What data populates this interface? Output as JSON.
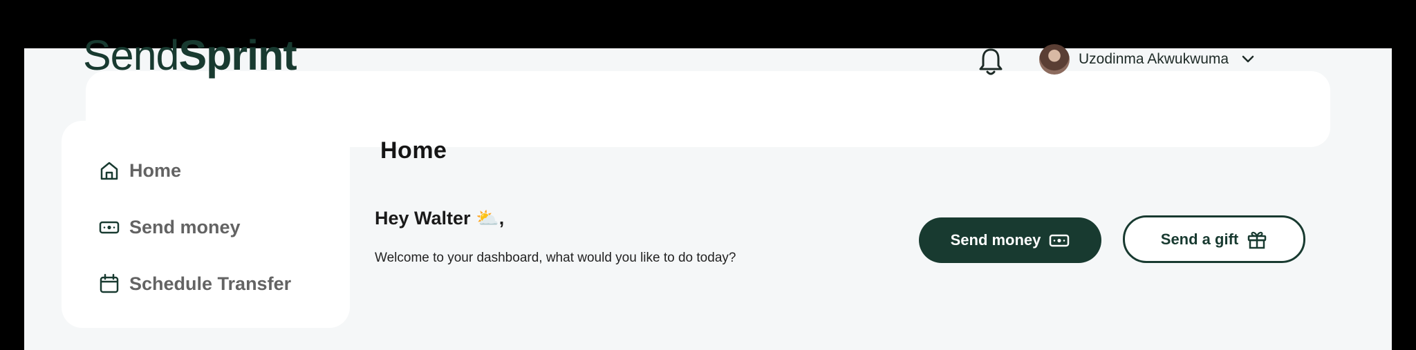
{
  "brand": {
    "logo_light": "Send",
    "logo_bold": "Sprint",
    "color": "#183a30"
  },
  "header": {
    "user_name": "Uzodinma Akwukwuma",
    "icons": [
      "bell-icon",
      "chevron-down-icon"
    ]
  },
  "sidebar": {
    "items": [
      {
        "label": "Home",
        "icon": "home-icon"
      },
      {
        "label": "Send money",
        "icon": "cash-icon"
      },
      {
        "label": "Schedule Transfer",
        "icon": "calendar-icon"
      }
    ]
  },
  "main": {
    "title": "Home",
    "greeting": "Hey Walter",
    "greeting_emoji": "⛅",
    "greeting_suffix": ",",
    "subtitle": "Welcome to your dashboard, what would you like to do today?",
    "actions": {
      "send_money_label": "Send money",
      "send_gift_label": "Send a gift"
    }
  },
  "colors": {
    "accent": "#183a30",
    "background": "#f5f7f8",
    "card": "#ffffff"
  }
}
